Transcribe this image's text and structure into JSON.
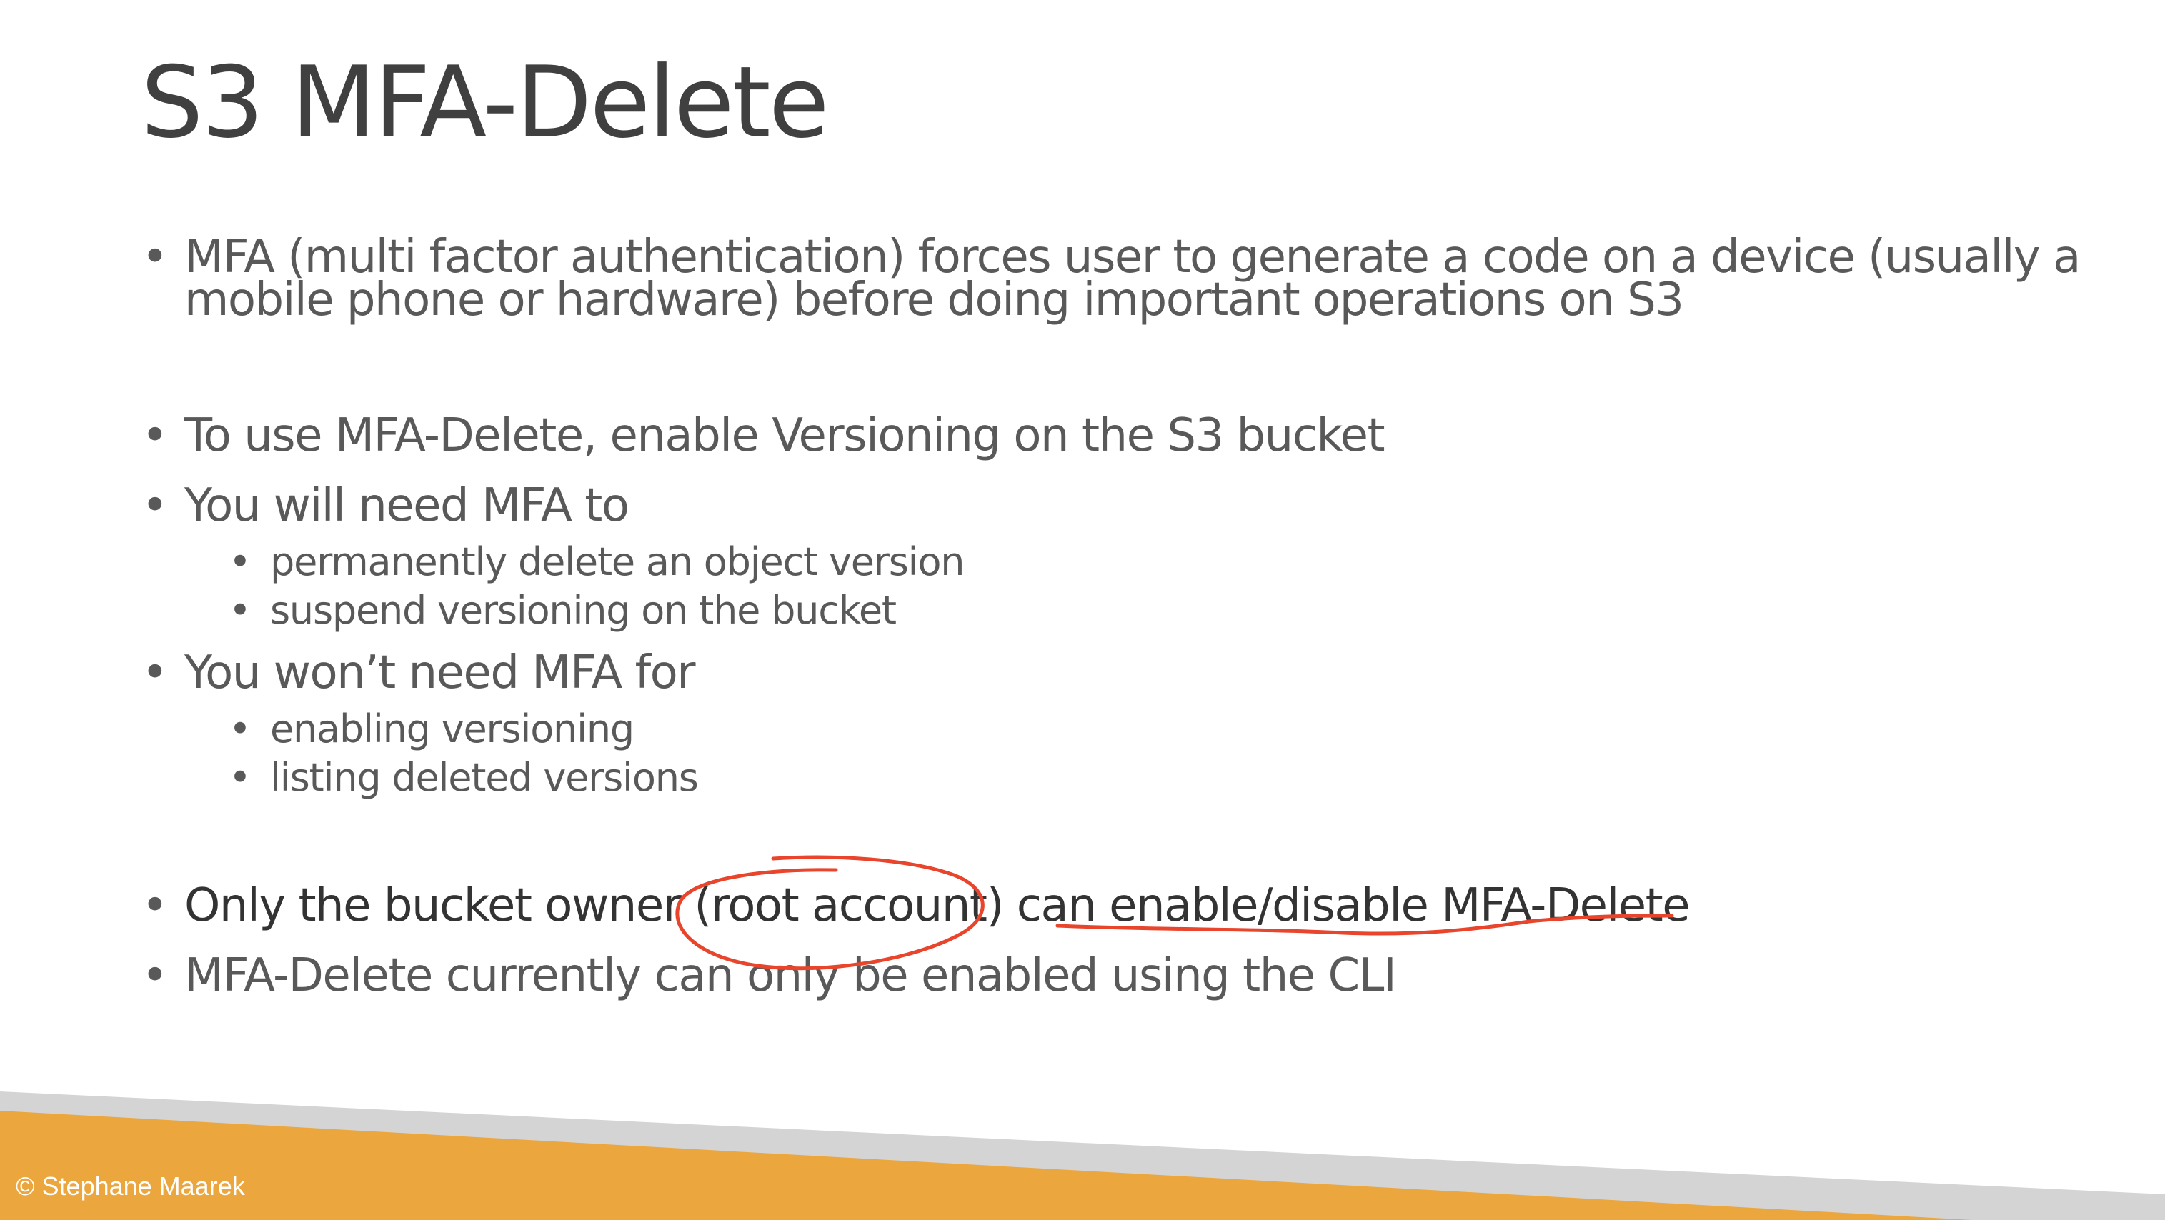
{
  "slide": {
    "title": "S3 MFA-Delete",
    "bullets": [
      {
        "text_line1": "MFA (multi factor authentication) forces user to generate a code on a device (usually a",
        "text_line2": "mobile phone or hardware) before doing important operations on S3"
      },
      {
        "text": "To use MFA-Delete, enable Versioning on the S3 bucket"
      },
      {
        "text": "You will need MFA to",
        "subitems": [
          "permanently delete an object version",
          "suspend versioning on the bucket"
        ]
      },
      {
        "text": "You won’t need MFA for",
        "subitems": [
          "enabling versioning",
          "listing deleted versions"
        ]
      },
      {
        "text": "Only the bucket owner (root account) can enable/disable MFA-Delete"
      },
      {
        "text": "MFA-Delete currently can only be enabled using the CLI"
      }
    ],
    "bullet_glyph": "•",
    "footer": "© Stephane Maarek"
  },
  "colors": {
    "title": "#404040",
    "body_text": "#595959",
    "emphasis_text": "#333333",
    "annotation": "#e8452c",
    "footer_orange": "#eba63e",
    "footer_gray": "#d4d4d4",
    "footer_text": "#ffffff"
  }
}
